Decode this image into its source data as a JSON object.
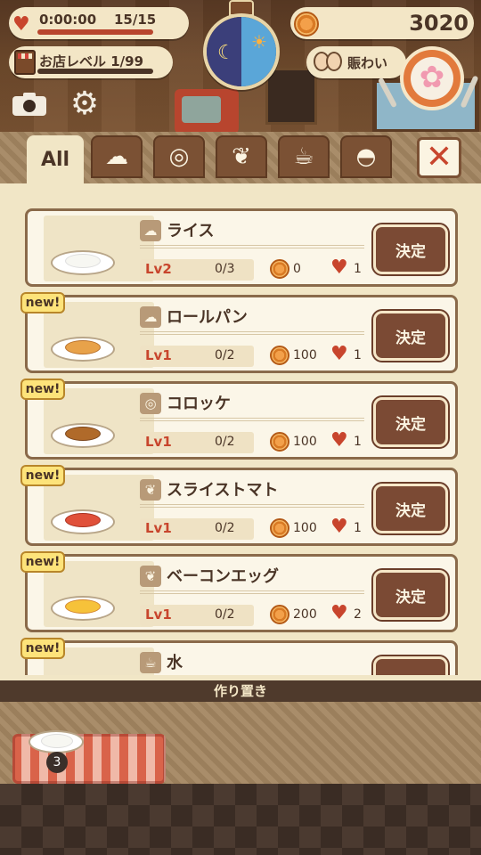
{
  "hud": {
    "timer": "0:00:00",
    "stamina": "15/15",
    "shop_level": "お店レベル 1/99",
    "coins": "3020",
    "busy_label": "賑わい"
  },
  "tabs": [
    {
      "label": "All",
      "active": true
    },
    {
      "icon": "rice-bowl-icon"
    },
    {
      "icon": "main-dish-icon"
    },
    {
      "icon": "salad-icon"
    },
    {
      "icon": "drink-icon"
    },
    {
      "icon": "dessert-icon"
    }
  ],
  "menu_items": [
    {
      "name": "ライス",
      "level": "Lv2",
      "progress": "0/3",
      "price": "0",
      "hearts": "1",
      "is_new": false,
      "button": "決定"
    },
    {
      "name": "ロールパン",
      "level": "Lv1",
      "progress": "0/2",
      "price": "100",
      "hearts": "1",
      "is_new": true,
      "button": "決定"
    },
    {
      "name": "コロッケ",
      "level": "Lv1",
      "progress": "0/2",
      "price": "100",
      "hearts": "1",
      "is_new": true,
      "button": "決定"
    },
    {
      "name": "スライストマト",
      "level": "Lv1",
      "progress": "0/2",
      "price": "100",
      "hearts": "1",
      "is_new": true,
      "button": "決定"
    },
    {
      "name": "ベーコンエッグ",
      "level": "Lv1",
      "progress": "0/2",
      "price": "200",
      "hearts": "2",
      "is_new": true,
      "button": "決定"
    },
    {
      "name": "水",
      "is_new": true
    }
  ],
  "badges": {
    "new": "new!"
  },
  "prep": {
    "title": "作り置き",
    "quantity": "3"
  },
  "colors": {
    "accent_red": "#c8452d",
    "button_brown": "#7b4a34",
    "panel_cream": "#f1e6c6"
  }
}
